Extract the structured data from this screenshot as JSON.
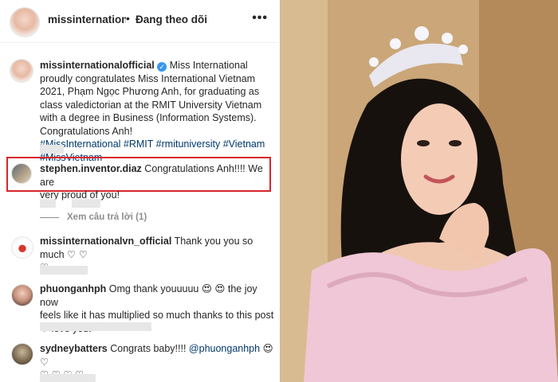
{
  "header": {
    "username": "missinternationalofficial",
    "dot": "•",
    "follow_label": "Đang theo dõi",
    "more": "•••"
  },
  "caption": {
    "username": "missinternationalofficial",
    "verified": "verified-badge",
    "text": "Miss International proudly congratulates Miss International Vietnam 2021, Phạm Ngọc Phương Anh, for graduating as class valedictorian at the RMIT University Vietnam with a degree in Business (Information Systems). Congratulations Anh!",
    "hashtags_line1": "#MissInternational #RMIT #rmituniversity #Vietnam",
    "hashtags_line2": "#MissVietnam"
  },
  "comments": [
    {
      "username": "stephen.inventor.diaz",
      "text_line1": "Congratulations Anh!!!! We are",
      "text_line2": "very proud of you!",
      "view_replies": "Xem câu trả lời (1)"
    },
    {
      "username": "missinternationalvn_official",
      "text": "Thank you you so much ♡ ♡",
      "line2": "♡"
    },
    {
      "username": "phuonganhph",
      "text_line1": "Omg thank youuuuu 😍 😍 the joy now",
      "text_line2": "feels like it has multiplied so much thanks to this post",
      "text_line3": "♡ love you!"
    },
    {
      "username": "sydneybatters",
      "text": "Congrats baby!!!! ",
      "mention": "@phuonganhph",
      "emoji": " 😍 ♡",
      "line2": "♡ ♡ ♡ ♡"
    }
  ],
  "colors": {
    "highlight_border": "#d7262d",
    "link": "#00376b",
    "muted": "#8e8e8e"
  }
}
